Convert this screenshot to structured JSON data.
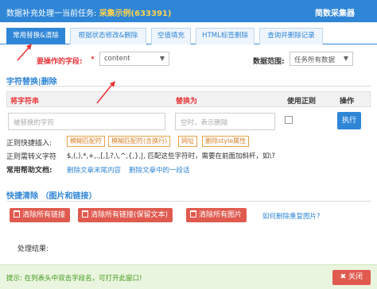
{
  "titlebar": {
    "prefix": "数据补充处理一当前任务: ",
    "task": "采集示例(633391)",
    "app_name": "简数采集器"
  },
  "tabs": [
    {
      "label": "常用替换&清除"
    },
    {
      "label": "根据状态修改&删除"
    },
    {
      "label": "空值填充"
    },
    {
      "label": "HTML标签删除"
    },
    {
      "label": "查询并删除记录"
    }
  ],
  "form": {
    "field_label": "要操作的字段:",
    "required_mark": "*",
    "field_value": "content",
    "range_label": "数据范围:",
    "range_value": "任务所有数据"
  },
  "replace": {
    "title": "字符替换|删除",
    "headers": {
      "target": "将字符串",
      "replace": "替换为",
      "regex": "使用正则",
      "action": "操作"
    },
    "target_placeholder": "被替换的字符",
    "replace_placeholder": "空时，表示删除",
    "execute_label": "执行",
    "quick_label": "正则快捷插入:",
    "quick_tags": [
      "模糊匹配符",
      "模糊匹配符(含换行)",
      "网址",
      "删除style属性"
    ],
    "escape_label": "正则需转义字符",
    "escape_text": "$,(,),*,+,.,[,],?,\\,^,{,},|, 匹配这些字符时，需要在前面加斜杆，如\\?",
    "help_label": "常用帮助文档:",
    "help_links": [
      "删除文章末尾内容",
      "删除文章中的一段话"
    ]
  },
  "quick_clear": {
    "title": "快捷清除 （图片和链接）",
    "buttons": [
      "清除所有链接",
      "清除所有链接(保留文本)",
      "清除所有图片"
    ],
    "help_link": "如何删除重复图片?"
  },
  "result_label": "处理结果:",
  "status": {
    "tip": "提示: 在列表头中双击字段名，可打开此窗口!",
    "close_label": "关闭"
  }
}
